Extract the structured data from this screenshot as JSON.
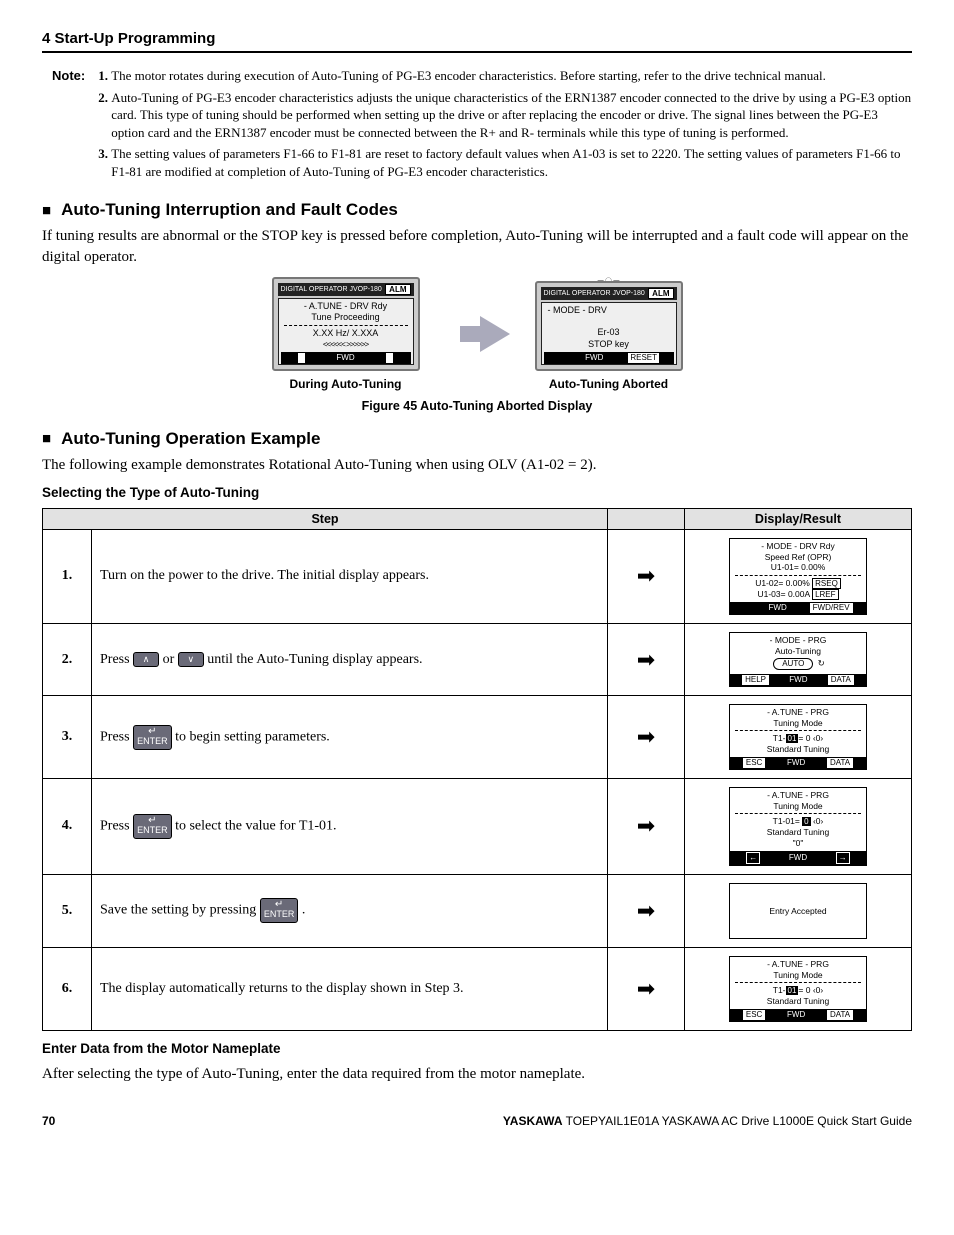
{
  "chapter": "4 Start-Up Programming",
  "note_label": "Note:",
  "notes": [
    "The motor rotates during execution of Auto-Tuning of PG-E3 encoder characteristics. Before starting, refer to the drive technical manual.",
    "Auto-Tuning of PG-E3 encoder characteristics adjusts the unique characteristics of the ERN1387 encoder connected to the drive by using a PG-E3 option card. This type of tuning should be performed when setting up the drive or after replacing the encoder or drive. The signal lines between the PG-E3 option card and the ERN1387 encoder must be connected between the R+ and R- terminals while this type of tuning is performed.",
    "The setting values of parameters F1-66 to F1-81 are reset to factory default values when A1-03 is set to 2220. The setting values of parameters F1-66 to F1-81 are modified at completion of Auto-Tuning of PG-E3 encoder characteristics."
  ],
  "sec_a_title": "Auto-Tuning Interruption and Fault Codes",
  "sec_a_text": "If tuning results are abnormal or the STOP key is pressed before completion, Auto-Tuning will be interrupted and a fault code will appear on the digital operator.",
  "fig": {
    "operator_bar": "DIGITAL OPERATOR JVOP-180",
    "alm": "ALM",
    "left_panel": {
      "l1": "- A.TUNE - DRV Rdy",
      "l2": "Tune Proceeding",
      "l3": "X.XX Hz/  X.XXA",
      "l4": "<<<<<<     >>>>>>",
      "foot": "FWD"
    },
    "right_panel": {
      "l1": "- MODE -    DRV",
      "l2": "Er-03",
      "l3": "STOP  key",
      "foot_fwd": "FWD",
      "foot_reset": "RESET"
    },
    "left_caption": "During Auto-Tuning",
    "right_caption": "Auto-Tuning Aborted",
    "caption": "Figure 45  Auto-Tuning Aborted Display"
  },
  "sec_b_title": "Auto-Tuning Operation Example",
  "sec_b_text": "The following example demonstrates Rotational Auto-Tuning when using OLV (A1-02 = 2).",
  "sec_b_sub": "Selecting the Type of Auto-Tuning",
  "tbl": {
    "h1": "Step",
    "h2": "Display/Result",
    "steps": [
      {
        "t": "Turn on the power to the drive. The initial display appears."
      },
      {
        "pre": "Press ",
        "k1": "∧",
        "mid": " or ",
        "k2": "∨",
        "post": " until the Auto-Tuning display appears."
      },
      {
        "pre": "Press ",
        "k1_enter": "ENTER",
        "post": " to begin setting parameters."
      },
      {
        "pre": "Press ",
        "k1_enter": "ENTER",
        "post": " to select the value for T1-01."
      },
      {
        "pre": "Save the setting by pressing ",
        "k1_enter": "ENTER",
        "post": " ."
      },
      {
        "t": "The display automatically returns to the display shown in Step 3."
      }
    ],
    "disp1": {
      "a": "- MODE -  DRV Rdy",
      "b": "Speed Ref (OPR)",
      "c": "U1-01=  0.00%",
      "d": "U1-02=  0.00%",
      "d2": "RSEQ",
      "e": "U1-03=  0.00A",
      "e2": "LREF",
      "f": "FWD",
      "f2": "FWD/REV"
    },
    "disp2": {
      "a": "- MODE -    PRG",
      "b": "Auto-Tuning",
      "auto": "AUTO",
      "h": "HELP",
      "f": "FWD",
      "d": "DATA"
    },
    "disp3": {
      "a": "- A.TUNE - PRG",
      "b": "Tuning Mode",
      "c": "T1-01= 0 ‹0›",
      "d": "Standard Tuning",
      "e": "ESC",
      "f": "FWD",
      "g": "DATA"
    },
    "disp4": {
      "a": "- A.TUNE - PRG",
      "b": "Tuning Mode",
      "c": "T1-01= 0 ‹0›",
      "d": "Standard Tuning",
      "q": "\"0\"",
      "l": "←",
      "f": "FWD",
      "r": "→"
    },
    "disp5": {
      "a": "Entry Accepted"
    },
    "disp6": {
      "a": "- A.TUNE - PRG",
      "b": "Tuning Mode",
      "c": "T1-01= 0 ‹0›",
      "d": "Standard Tuning",
      "e": "ESC",
      "f": "FWD",
      "g": "DATA"
    }
  },
  "sec_c_sub": "Enter Data from the Motor Nameplate",
  "sec_c_text": "After selecting the type of Auto-Tuning, enter the data required from the motor nameplate.",
  "footer": {
    "pn": "70",
    "brand": "YASKAWA",
    "doc": " TOEPYAIL1E01A YASKAWA AC Drive L1000E Quick Start Guide"
  }
}
